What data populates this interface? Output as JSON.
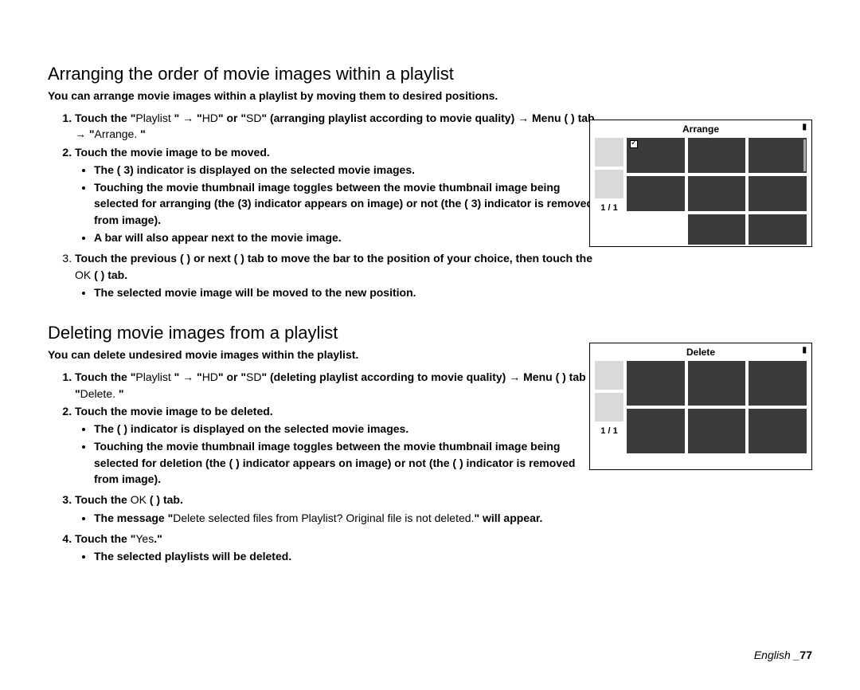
{
  "section1": {
    "title": "Arranging the order of movie images within a playlist",
    "intro": "You can arrange movie images within a playlist by moving them to desired positions.",
    "step1_a": "Touch the \"",
    "step1_b": "Playlist",
    "step1_c": " \" → \"",
    "step1_d": "HD",
    "step1_e": "\" or \"",
    "step1_f": "SD",
    "step1_g": "\" (arranging playlist according to movie quality) → Menu (     ) tab → \"",
    "step1_h": "Arrange.",
    "step1_i": " \"",
    "step2": "Touch the movie image to be moved.",
    "step2_b1": "The ( 3) indicator is displayed on the selected movie images.",
    "step2_b2": "Touching the movie thumbnail image toggles between the movie thumbnail image being selected for arranging (the (3) indicator appears on image) or not (the ( 3) indicator is removed from image).",
    "step2_b3": "A bar will also appear next to the movie image.",
    "step3": "Touch the previous (     ) or next (     ) tab to move the bar to the position of your choice, then touch the ",
    "step3_ok": "OK",
    "step3_tail": " (     ) tab.",
    "step3_b1": "The selected movie image will be moved to the new position."
  },
  "section2": {
    "title": "Deleting movie images from a playlist",
    "intro": "You can delete undesired movie images within the playlist.",
    "step1_a": "Touch the \"",
    "step1_b": "Playlist",
    "step1_c": " \" → \"",
    "step1_d": "HD",
    "step1_e": "\" or \"",
    "step1_f": "SD",
    "step1_g": "\" (deleting playlist according to movie quality) → Menu (     ) tab → \"",
    "step1_h": "Delete.",
    "step1_i": " \"",
    "step2": "Touch the movie image to be deleted.",
    "step2_b1": "The (     ) indicator is displayed on the selected movie images.",
    "step2_b2": "Touching the movie thumbnail image toggles between the movie thumbnail image being selected for deletion (the (  ) indicator appears on image) or not (the (     ) indicator is removed from image).",
    "step3_a": "Touch the ",
    "step3_ok": "OK",
    "step3_tail": " (     ) tab.",
    "step3_b1_a": "The message \"",
    "step3_b1_b": "Delete selected files from Playlist? Original file is not deleted.",
    "step3_b1_c": "\" will appear.",
    "step4_a": "Touch the \"",
    "step4_b": "Yes",
    "step4_c": ".\"",
    "step4_b1": "The selected playlists will be deleted."
  },
  "screens": {
    "arrange": {
      "title": "Arrange",
      "page": "1 / 1"
    },
    "delete": {
      "title": "Delete",
      "page": "1 / 1"
    }
  },
  "footer": {
    "lang": "English _",
    "page": "77"
  }
}
